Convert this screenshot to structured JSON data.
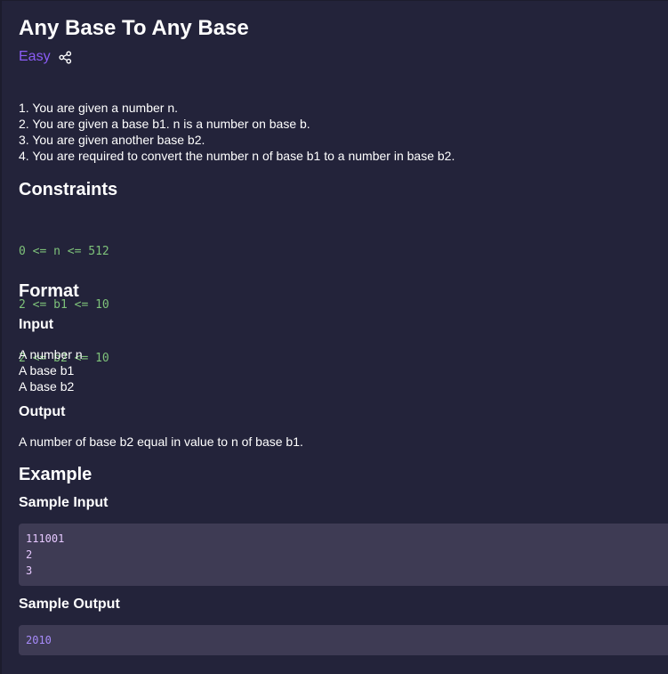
{
  "problem": {
    "title": "Any Base To Any Base",
    "difficulty": "Easy",
    "description": [
      "1. You are given a number n.",
      "2. You are given a base b1. n is a number on base b.",
      "3. You are given another base b2.",
      "4. You are required to convert the number n of base b1 to a number in base b2."
    ]
  },
  "constraints": {
    "heading": "Constraints",
    "lines": [
      "0 <= n <= 512",
      "2 <= b1 <= 10",
      "2 <= b2 <= 10"
    ]
  },
  "format": {
    "heading": "Format",
    "input_heading": "Input",
    "input_lines": [
      "A number n",
      "A base b1",
      "A base b2"
    ],
    "output_heading": "Output",
    "output_line": "A number of base b2 equal in value to n of base b1."
  },
  "example": {
    "heading": "Example",
    "sample_input_heading": "Sample Input",
    "sample_input_lines": [
      "111001",
      "2",
      "3"
    ],
    "sample_output_heading": "Sample Output",
    "sample_output": "2010"
  },
  "icons": {
    "share": "share-icon"
  },
  "colors": {
    "background": "#23233a",
    "difficulty": "#8b5cf6",
    "constraint_text": "#7ec27a",
    "code_background": "#3e3b54",
    "sample_output_text": "#a78bfa"
  }
}
